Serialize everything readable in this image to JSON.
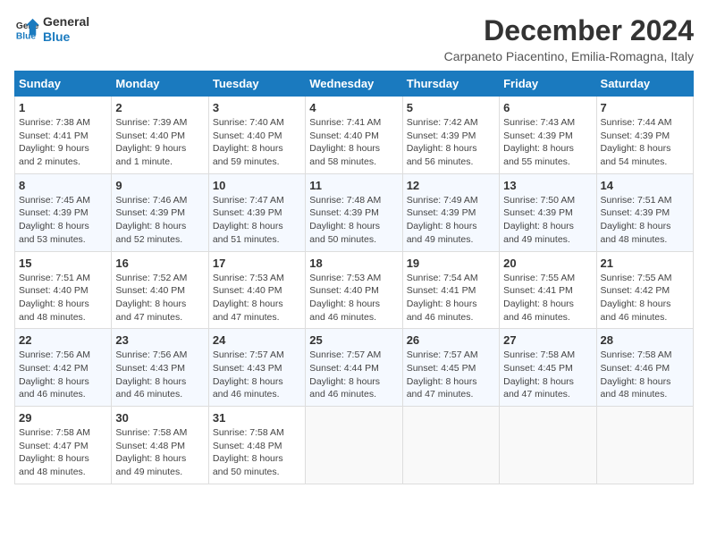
{
  "header": {
    "logo_line1": "General",
    "logo_line2": "Blue",
    "month_year": "December 2024",
    "location": "Carpaneto Piacentino, Emilia-Romagna, Italy"
  },
  "columns": [
    "Sunday",
    "Monday",
    "Tuesday",
    "Wednesday",
    "Thursday",
    "Friday",
    "Saturday"
  ],
  "weeks": [
    [
      {
        "day": "1",
        "info": "Sunrise: 7:38 AM\nSunset: 4:41 PM\nDaylight: 9 hours\nand 2 minutes."
      },
      {
        "day": "2",
        "info": "Sunrise: 7:39 AM\nSunset: 4:40 PM\nDaylight: 9 hours\nand 1 minute."
      },
      {
        "day": "3",
        "info": "Sunrise: 7:40 AM\nSunset: 4:40 PM\nDaylight: 8 hours\nand 59 minutes."
      },
      {
        "day": "4",
        "info": "Sunrise: 7:41 AM\nSunset: 4:40 PM\nDaylight: 8 hours\nand 58 minutes."
      },
      {
        "day": "5",
        "info": "Sunrise: 7:42 AM\nSunset: 4:39 PM\nDaylight: 8 hours\nand 56 minutes."
      },
      {
        "day": "6",
        "info": "Sunrise: 7:43 AM\nSunset: 4:39 PM\nDaylight: 8 hours\nand 55 minutes."
      },
      {
        "day": "7",
        "info": "Sunrise: 7:44 AM\nSunset: 4:39 PM\nDaylight: 8 hours\nand 54 minutes."
      }
    ],
    [
      {
        "day": "8",
        "info": "Sunrise: 7:45 AM\nSunset: 4:39 PM\nDaylight: 8 hours\nand 53 minutes."
      },
      {
        "day": "9",
        "info": "Sunrise: 7:46 AM\nSunset: 4:39 PM\nDaylight: 8 hours\nand 52 minutes."
      },
      {
        "day": "10",
        "info": "Sunrise: 7:47 AM\nSunset: 4:39 PM\nDaylight: 8 hours\nand 51 minutes."
      },
      {
        "day": "11",
        "info": "Sunrise: 7:48 AM\nSunset: 4:39 PM\nDaylight: 8 hours\nand 50 minutes."
      },
      {
        "day": "12",
        "info": "Sunrise: 7:49 AM\nSunset: 4:39 PM\nDaylight: 8 hours\nand 49 minutes."
      },
      {
        "day": "13",
        "info": "Sunrise: 7:50 AM\nSunset: 4:39 PM\nDaylight: 8 hours\nand 49 minutes."
      },
      {
        "day": "14",
        "info": "Sunrise: 7:51 AM\nSunset: 4:39 PM\nDaylight: 8 hours\nand 48 minutes."
      }
    ],
    [
      {
        "day": "15",
        "info": "Sunrise: 7:51 AM\nSunset: 4:40 PM\nDaylight: 8 hours\nand 48 minutes."
      },
      {
        "day": "16",
        "info": "Sunrise: 7:52 AM\nSunset: 4:40 PM\nDaylight: 8 hours\nand 47 minutes."
      },
      {
        "day": "17",
        "info": "Sunrise: 7:53 AM\nSunset: 4:40 PM\nDaylight: 8 hours\nand 47 minutes."
      },
      {
        "day": "18",
        "info": "Sunrise: 7:53 AM\nSunset: 4:40 PM\nDaylight: 8 hours\nand 46 minutes."
      },
      {
        "day": "19",
        "info": "Sunrise: 7:54 AM\nSunset: 4:41 PM\nDaylight: 8 hours\nand 46 minutes."
      },
      {
        "day": "20",
        "info": "Sunrise: 7:55 AM\nSunset: 4:41 PM\nDaylight: 8 hours\nand 46 minutes."
      },
      {
        "day": "21",
        "info": "Sunrise: 7:55 AM\nSunset: 4:42 PM\nDaylight: 8 hours\nand 46 minutes."
      }
    ],
    [
      {
        "day": "22",
        "info": "Sunrise: 7:56 AM\nSunset: 4:42 PM\nDaylight: 8 hours\nand 46 minutes."
      },
      {
        "day": "23",
        "info": "Sunrise: 7:56 AM\nSunset: 4:43 PM\nDaylight: 8 hours\nand 46 minutes."
      },
      {
        "day": "24",
        "info": "Sunrise: 7:57 AM\nSunset: 4:43 PM\nDaylight: 8 hours\nand 46 minutes."
      },
      {
        "day": "25",
        "info": "Sunrise: 7:57 AM\nSunset: 4:44 PM\nDaylight: 8 hours\nand 46 minutes."
      },
      {
        "day": "26",
        "info": "Sunrise: 7:57 AM\nSunset: 4:45 PM\nDaylight: 8 hours\nand 47 minutes."
      },
      {
        "day": "27",
        "info": "Sunrise: 7:58 AM\nSunset: 4:45 PM\nDaylight: 8 hours\nand 47 minutes."
      },
      {
        "day": "28",
        "info": "Sunrise: 7:58 AM\nSunset: 4:46 PM\nDaylight: 8 hours\nand 48 minutes."
      }
    ],
    [
      {
        "day": "29",
        "info": "Sunrise: 7:58 AM\nSunset: 4:47 PM\nDaylight: 8 hours\nand 48 minutes."
      },
      {
        "day": "30",
        "info": "Sunrise: 7:58 AM\nSunset: 4:48 PM\nDaylight: 8 hours\nand 49 minutes."
      },
      {
        "day": "31",
        "info": "Sunrise: 7:58 AM\nSunset: 4:48 PM\nDaylight: 8 hours\nand 50 minutes."
      },
      {
        "day": "",
        "info": ""
      },
      {
        "day": "",
        "info": ""
      },
      {
        "day": "",
        "info": ""
      },
      {
        "day": "",
        "info": ""
      }
    ]
  ]
}
